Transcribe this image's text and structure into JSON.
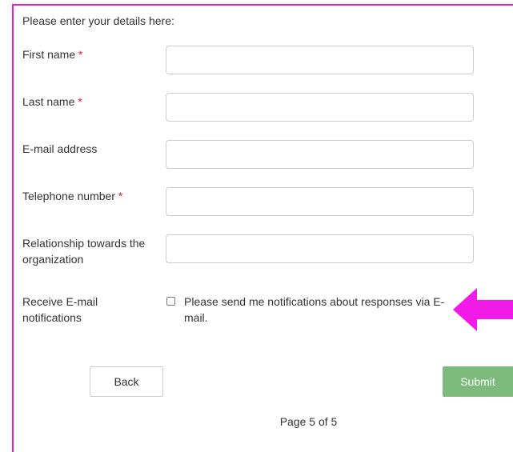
{
  "intro": "Please enter your details here:",
  "fields": [
    {
      "label": "First name",
      "required_mark": "*",
      "value": ""
    },
    {
      "label": "Last name",
      "required_mark": "*",
      "value": ""
    },
    {
      "label": "E-mail address",
      "required_mark": "",
      "value": ""
    },
    {
      "label": "Telephone number",
      "required_mark": "*",
      "value": ""
    },
    {
      "label": "Relationship towards the organization",
      "required_mark": "",
      "value": ""
    }
  ],
  "notifications": {
    "label": "Receive E-mail notifications",
    "checkbox_label": "Please send me notifications about responses via E-mail.",
    "checked": false
  },
  "buttons": {
    "back": "Back",
    "submit": "Submit"
  },
  "pager": "Page 5 of 5",
  "colors": {
    "frame": "#e61ed4",
    "arrow": "#f21ae6",
    "submit_bg": "#7dbb7d",
    "required": "#e02020"
  },
  "annotation": {
    "icon": "pointer-arrow-icon"
  }
}
